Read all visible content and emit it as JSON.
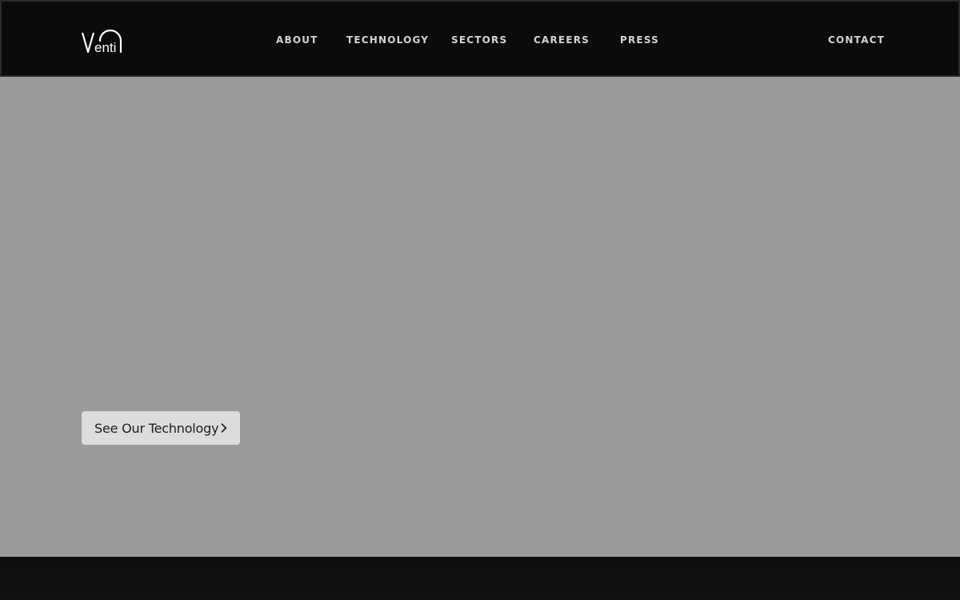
{
  "header": {
    "logo_text": "Venti",
    "nav": [
      {
        "label": "ABOUT"
      },
      {
        "label": "TECHNOLOGY"
      },
      {
        "label": "SECTORS"
      },
      {
        "label": "CAREERS"
      },
      {
        "label": "PRESS"
      }
    ],
    "contact_label": "CONTACT"
  },
  "hero": {
    "cta_label": "See Our Technology",
    "cta_icon": "chevron-right-icon"
  },
  "colors": {
    "header_bg": "#0b0b0c",
    "hero_bg": "#9a9a9a",
    "cta_bg": "#dcdcdc",
    "nav_text": "#d4d4d4"
  }
}
